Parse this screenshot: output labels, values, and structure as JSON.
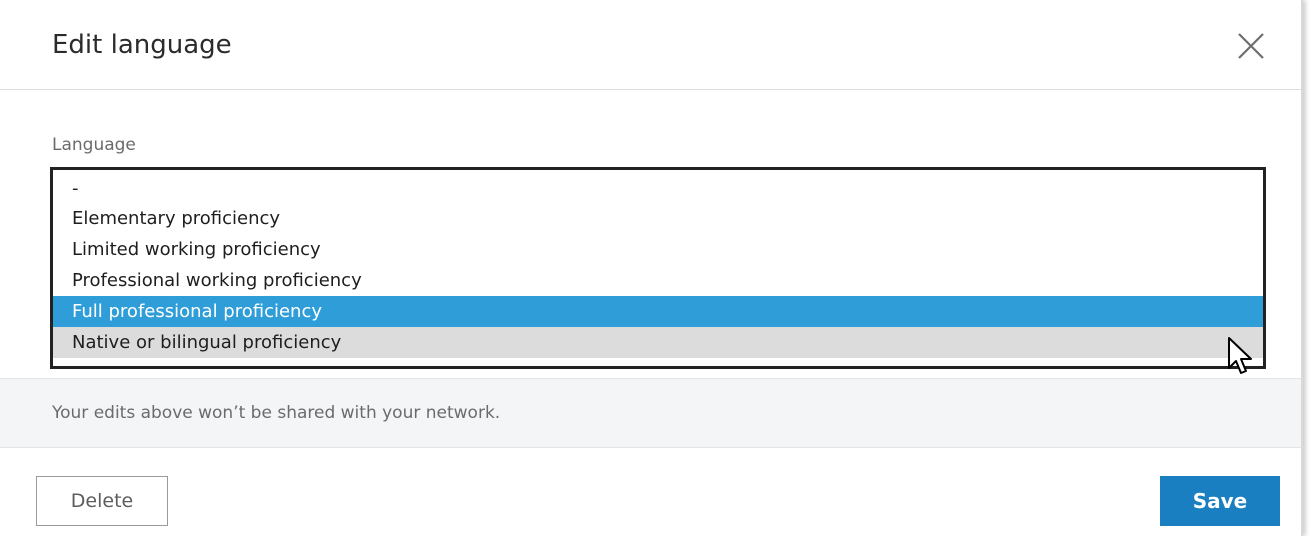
{
  "dialog": {
    "title": "Edit language",
    "close_icon": "close-icon"
  },
  "field": {
    "label": "Language"
  },
  "proficiency_options": [
    "-",
    "Elementary proficiency",
    "Limited working proficiency",
    "Professional working proficiency",
    "Full professional proficiency",
    "Native or bilingual proficiency"
  ],
  "selected_option": "Full professional proficiency",
  "hovered_option": "Native or bilingual proficiency",
  "notice": {
    "text": "Your edits above won’t be shared with your network."
  },
  "footer": {
    "delete_label": "Delete",
    "save_label": "Save"
  },
  "colors": {
    "selected_bg": "#2e9dd8",
    "hover_bg": "#dcdcdc",
    "save_bg": "#1a7fc0",
    "notice_bg": "#f3f5f7"
  },
  "cursor_icon": "mouse-pointer-icon"
}
